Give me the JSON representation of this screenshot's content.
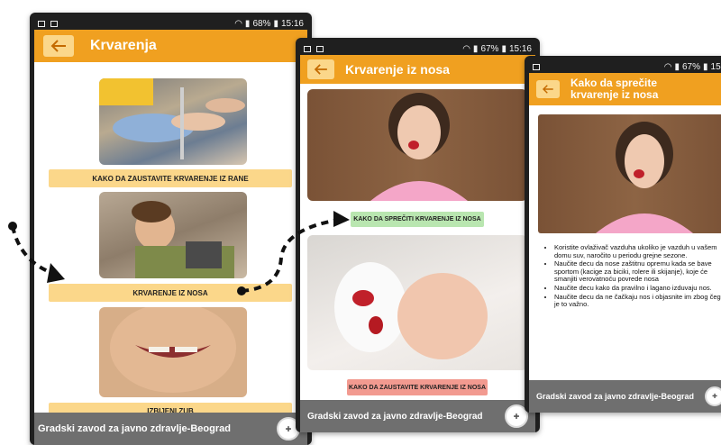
{
  "screen1": {
    "status_time": "15:16",
    "status_battery": "68%",
    "title": "Krvarenja",
    "back_icon": "arrow-left-icon",
    "cards": [
      {
        "label": "KAKO DA ZAUSTAVITE KRVARENJE IZ RANE"
      },
      {
        "label": "KRVARENJE IZ NOSA"
      },
      {
        "label": "IZBIJENI ZUB"
      }
    ],
    "footer": "Gradski zavod za javno zdravlje-Beograd"
  },
  "screen2": {
    "status_time": "15:16",
    "status_battery": "67%",
    "title": "Krvarenje iz nosa",
    "back_icon": "arrow-left-icon",
    "cards": [
      {
        "label": "KAKO DA SPREČITI KRVARENJE IZ NOSA"
      },
      {
        "label": "KAKO DA ZAUSTAVITE KRVARENJE IZ NOSA"
      }
    ],
    "footer": "Gradski zavod za javno zdravlje-Beograd"
  },
  "screen3": {
    "status_time": "15:1",
    "status_battery": "67%",
    "title_line1": "Kako da sprečite",
    "title_line2": "krvarenje iz nosa",
    "back_icon": "arrow-left-icon",
    "tips": [
      "Koristite ovlaživač vazduha ukoliko je vazduh u vašem domu suv, naročito u periodu grejne sezone.",
      "Naučite decu da nose zaštitnu opremu kada se bave sportom (kacige za biciki, rolere ili skijanje), koje će smanjiti verovatnoću povrede nosa",
      "Naučite decu kako da pravilno i lagano izduvaju nos.",
      "Naučite decu da ne čačkaju nos i objasnite im zbog čega je to važno."
    ],
    "footer": "Gradski zavod za javno zdravlje-Beograd"
  },
  "colors": {
    "accent": "#f0a020",
    "label_yellow": "#fbd78a",
    "label_green": "#b9e6b0",
    "label_red": "#f29a90",
    "footer_gray": "#6f6f6f"
  }
}
